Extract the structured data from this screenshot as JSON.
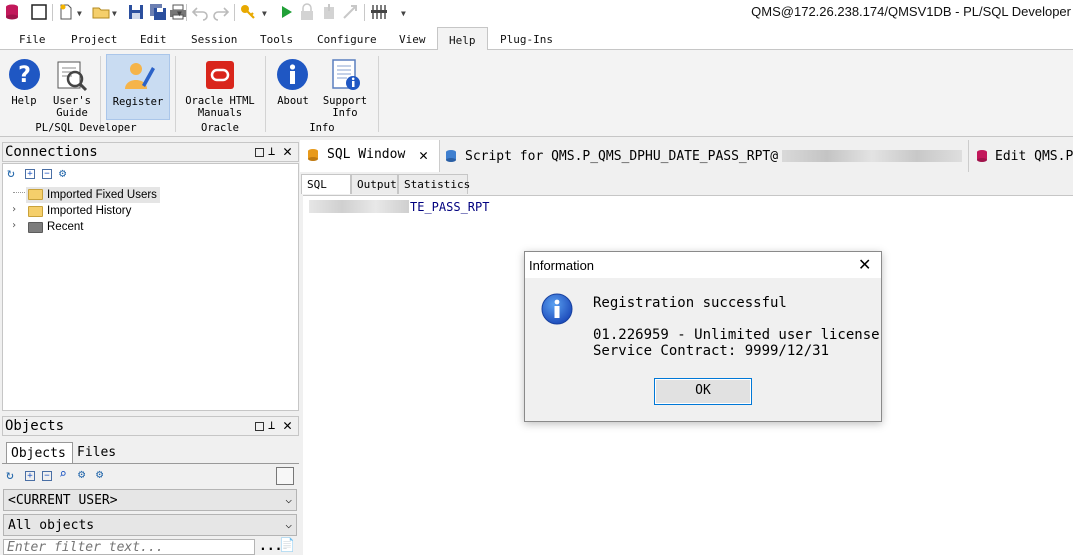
{
  "window": {
    "title": "QMS@172.26.238.174/QMSV1DB - PL/SQL Developer"
  },
  "menu": {
    "tabs": [
      "File",
      "Project",
      "Edit",
      "Session",
      "Tools",
      "Configure",
      "View",
      "Help",
      "Plug-Ins"
    ],
    "active": "Help"
  },
  "ribbon": {
    "help": "Help",
    "users_guide_1": "User's",
    "users_guide_2": "Guide",
    "register": "Register",
    "oracle_html_1": "Oracle HTML",
    "oracle_html_2": "Manuals",
    "about": "About",
    "support_1": "Support",
    "support_2": "Info",
    "group_plsql": "PL/SQL Developer",
    "group_oracle": "Oracle",
    "group_info": "Info"
  },
  "connections": {
    "title": "Connections",
    "items": [
      "Imported Fixed Users",
      "Imported History",
      "Recent"
    ]
  },
  "objects": {
    "title": "Objects",
    "tab_objects": "Objects",
    "tab_files": "Files",
    "user_combo": "<CURRENT USER>",
    "type_combo": "All objects",
    "filter_placeholder": "Enter filter text...",
    "filter_button": "..."
  },
  "editor": {
    "tabs": {
      "sql_window": "SQL Window",
      "script": "Script for QMS.P_QMS_DPHU_DATE_PASS_RPT@",
      "edit": "Edit QMS.P"
    },
    "subtabs": [
      "SQL",
      "Output",
      "Statistics"
    ],
    "code_line": "TE_PASS_RPT"
  },
  "dialog": {
    "title": "Information",
    "heading": "Registration successful",
    "line1": "01.226959 - Unlimited user license",
    "line2": "Service Contract: 9999/12/31",
    "ok": "OK"
  },
  "colors": {
    "accent": "#0078d7",
    "info_blue": "#1f57c3",
    "oracle_red": "#d9261c"
  }
}
